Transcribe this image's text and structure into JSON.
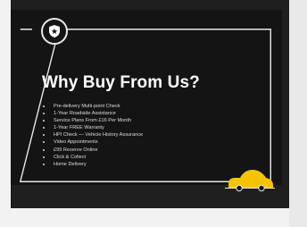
{
  "section": {
    "title": "Why Buy From Us?",
    "badge_icon": "shield-star-icon",
    "mascot_icon": "yellow-car-icon",
    "features": [
      "Pre-delivery Multi-point Check",
      "1-Year Roadside Assistance",
      "Service Plans From £16 Per Month",
      "1-Year FREE Warranty",
      "HPI Check — Vehicle History Assurance",
      "Video Appointments",
      "£99 Reserve Online",
      "Click & Collect",
      "Home Delivery"
    ]
  },
  "colors": {
    "page_background": "#f2f2f2",
    "frame": "#1f1f1f",
    "card": "#141414",
    "text": "#ffffff",
    "accent_yellow": "#f5c400"
  }
}
